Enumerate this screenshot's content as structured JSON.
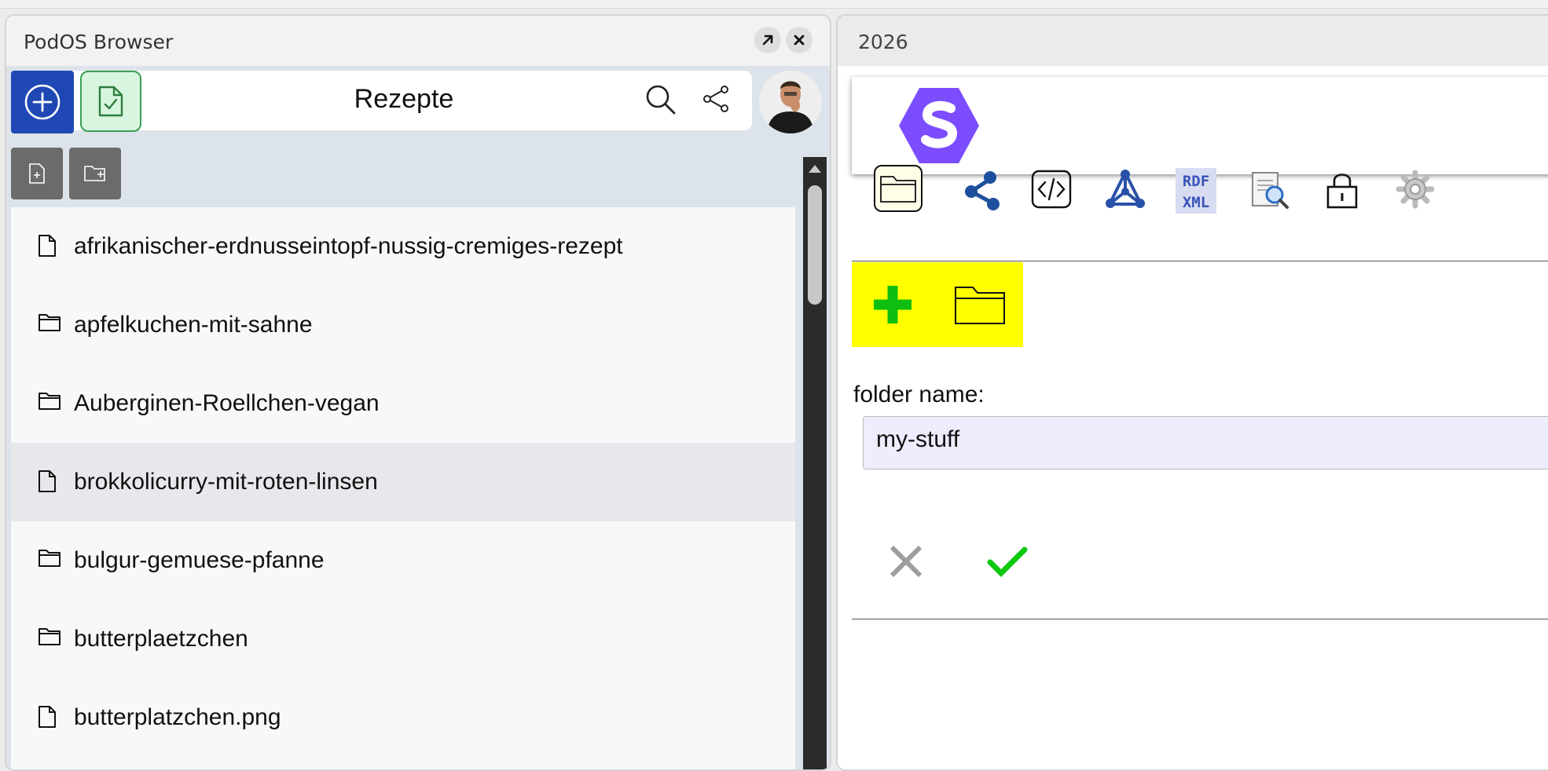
{
  "left_window": {
    "title": "PodOS Browser",
    "current_folder": "Rezepte",
    "files": [
      {
        "name": "afrikanischer-erdnusseintopf-nussig-cremiges-rezept",
        "type": "file",
        "selected": false
      },
      {
        "name": "apfelkuchen-mit-sahne",
        "type": "folder",
        "selected": false
      },
      {
        "name": "Auberginen-Roellchen-vegan",
        "type": "folder",
        "selected": false
      },
      {
        "name": "brokkolicurry-mit-roten-linsen",
        "type": "file",
        "selected": true
      },
      {
        "name": "bulgur-gemuese-pfanne",
        "type": "folder",
        "selected": false
      },
      {
        "name": "butterplaetzchen",
        "type": "folder",
        "selected": false
      },
      {
        "name": "butterplatzchen.png",
        "type": "file",
        "selected": false
      }
    ],
    "icons": {
      "maximize": "arrow-up-right-icon",
      "close": "close-icon",
      "add": "plus-circle-icon",
      "check_document": "document-check-icon",
      "search": "search-icon",
      "share": "share-icon",
      "new_file": "new-file-icon",
      "new_folder": "new-folder-icon"
    },
    "colors": {
      "add_button": "#1f48b4",
      "check_button_bg": "#d8f5df",
      "check_button_border": "#3aa055"
    }
  },
  "right_window": {
    "title": "2026",
    "pane_icons": [
      "folder-icon",
      "network-icon",
      "source-code-icon",
      "graph-icon",
      "rdf-xml-icon",
      "inspect-icon",
      "lock-icon",
      "settings-icon"
    ],
    "rdf_label_top": "RDF",
    "rdf_label_bottom": "XML",
    "new_folder_form": {
      "label": "folder name:",
      "input_value": "my-stuff"
    },
    "colors": {
      "highlight": "#ffff00",
      "add_plus": "#0fbf0f",
      "logo": "#7c4dff",
      "confirm": "#10c810",
      "cancel": "#9e9e9e"
    }
  }
}
